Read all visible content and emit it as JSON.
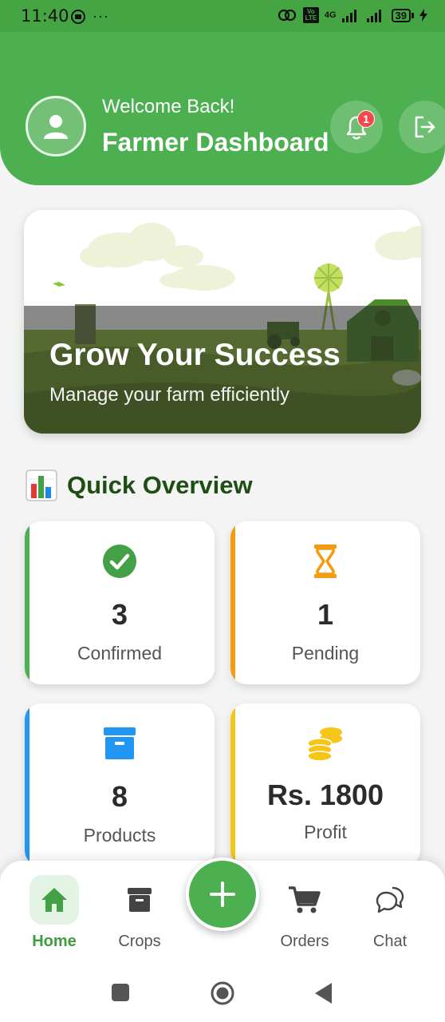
{
  "status_bar": {
    "time": "11:40",
    "dots": "···",
    "network": "4G",
    "volte": "Vo LTE",
    "battery": "39"
  },
  "header": {
    "welcome": "Welcome Back!",
    "title": "Farmer Dashboard",
    "notification_count": "1",
    "background_color": "#4caf50"
  },
  "banner": {
    "title": "Grow Your Success",
    "subtitle": "Manage your farm efficiently"
  },
  "overview": {
    "title": "Quick Overview",
    "icon": "bar-chart-icon",
    "cards": [
      {
        "value": "3",
        "label": "Confirmed",
        "icon": "check-circle-icon",
        "accent": "#4caf50"
      },
      {
        "value": "1",
        "label": "Pending",
        "icon": "hourglass-icon",
        "accent": "#f39c12"
      },
      {
        "value": "8",
        "label": "Products",
        "icon": "archive-box-icon",
        "accent": "#2196f3"
      },
      {
        "value": "Rs. 1800",
        "label": "Profit",
        "icon": "coins-icon",
        "accent": "#f5c518"
      }
    ]
  },
  "bottom_nav": {
    "items": [
      {
        "label": "Home",
        "icon": "home-icon",
        "active": true
      },
      {
        "label": "Crops",
        "icon": "archive-icon",
        "active": false
      },
      {
        "label": "Orders",
        "icon": "cart-icon",
        "active": false
      },
      {
        "label": "Chat",
        "icon": "chat-bubbles-icon",
        "active": false
      }
    ],
    "fab_icon": "plus-icon"
  }
}
